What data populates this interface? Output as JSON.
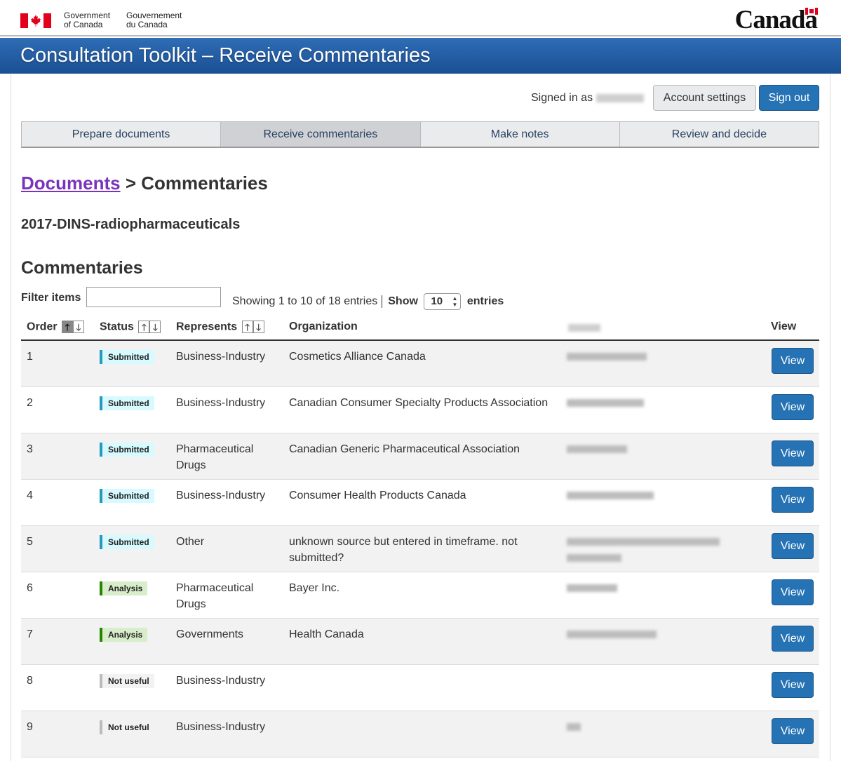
{
  "gov": {
    "en_line1": "Government",
    "en_line2": "of Canada",
    "fr_line1": "Gouvernement",
    "fr_line2": "du Canada",
    "wordmark": "Canada"
  },
  "app": {
    "title": "Consultation Toolkit – Receive Commentaries"
  },
  "account": {
    "signed_in_label": "Signed in as",
    "settings_label": "Account settings",
    "signout_label": "Sign out"
  },
  "tabs": [
    {
      "label": "Prepare documents",
      "active": false
    },
    {
      "label": "Receive commentaries",
      "active": true
    },
    {
      "label": "Make notes",
      "active": false
    },
    {
      "label": "Review and decide",
      "active": false
    }
  ],
  "breadcrumb": {
    "link": "Documents",
    "separator": ">",
    "current": "Commentaries"
  },
  "document_name": "2017-DINS-radiopharmaceuticals",
  "section_title": "Commentaries",
  "filter": {
    "label": "Filter items",
    "value": ""
  },
  "table_info": {
    "showing": "Showing 1 to 10 of 18 entries",
    "show_label": "Show",
    "page_length": "10",
    "entries_label": "entries"
  },
  "columns": {
    "order": "Order",
    "status": "Status",
    "represents": "Represents",
    "organization": "Organization",
    "view": "View"
  },
  "icons": {
    "sort_up": "sort-up-icon",
    "sort_down": "sort-down-icon"
  },
  "colors": {
    "primary": "#2572b4",
    "title_bar": "#26619f",
    "submitted": "#269abc",
    "analysis": "#278400",
    "not_useful": "#bbbbbb",
    "link_visited": "#7834bc"
  },
  "rows": [
    {
      "order": "1",
      "status": "Submitted",
      "status_class": "submitted",
      "represents": "Business-Industry",
      "organization": "Cosmetics Alliance Canada",
      "view_label": "View"
    },
    {
      "order": "2",
      "status": "Submitted",
      "status_class": "submitted",
      "represents": "Business-Industry",
      "organization": "Canadian Consumer Specialty Products Association",
      "view_label": "View"
    },
    {
      "order": "3",
      "status": "Submitted",
      "status_class": "submitted",
      "represents": "Pharmaceutical Drugs",
      "organization": "Canadian Generic Pharmaceutical Association",
      "view_label": "View"
    },
    {
      "order": "4",
      "status": "Submitted",
      "status_class": "submitted",
      "represents": "Business-Industry",
      "organization": "Consumer Health Products Canada",
      "view_label": "View"
    },
    {
      "order": "5",
      "status": "Submitted",
      "status_class": "submitted",
      "represents": "Other",
      "organization": "unknown source but entered in timeframe. not submitted?",
      "view_label": "View"
    },
    {
      "order": "6",
      "status": "Analysis",
      "status_class": "analysis",
      "represents": "Pharmaceutical Drugs",
      "organization": "Bayer Inc.",
      "view_label": "View"
    },
    {
      "order": "7",
      "status": "Analysis",
      "status_class": "analysis",
      "represents": "Governments",
      "organization": "Health Canada",
      "view_label": "View"
    },
    {
      "order": "8",
      "status": "Not useful",
      "status_class": "notuseful",
      "represents": "Business-Industry",
      "organization": "",
      "view_label": "View"
    },
    {
      "order": "9",
      "status": "Not useful",
      "status_class": "notuseful",
      "represents": "Business-Industry",
      "organization": "",
      "view_label": "View"
    }
  ]
}
